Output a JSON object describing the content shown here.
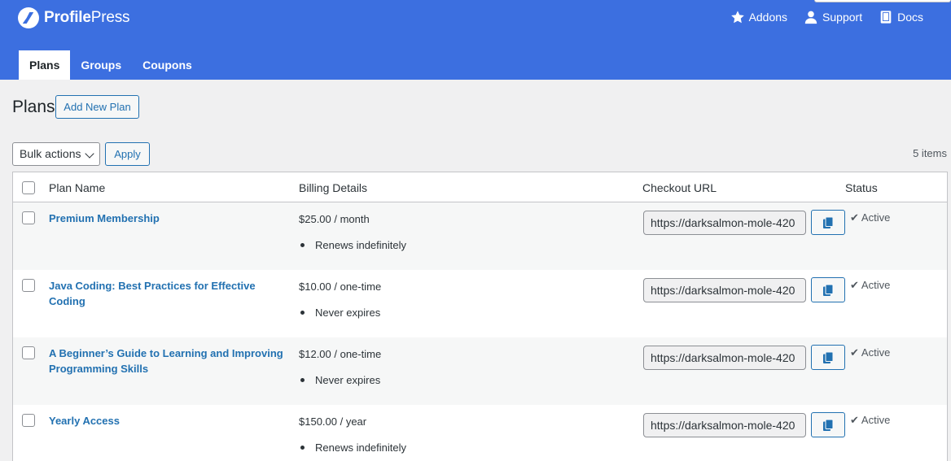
{
  "brand": {
    "name_bold": "Profile",
    "name_light": "Press"
  },
  "topnav": [
    {
      "label": "Addons",
      "icon": "star-icon"
    },
    {
      "label": "Support",
      "icon": "user-icon"
    },
    {
      "label": "Docs",
      "icon": "book-icon"
    }
  ],
  "tabs": [
    {
      "label": "Plans",
      "active": true
    },
    {
      "label": "Groups",
      "active": false
    },
    {
      "label": "Coupons",
      "active": false
    }
  ],
  "page": {
    "title": "Plans",
    "add_new_label": "Add New Plan"
  },
  "toolbar": {
    "bulk_actions": "Bulk actions",
    "apply_label": "Apply",
    "items_count": "5 items"
  },
  "table": {
    "columns": [
      "Plan Name",
      "Billing Details",
      "Checkout URL",
      "Status"
    ],
    "rows": [
      {
        "name": "Premium Membership",
        "price": "$25.00 / month",
        "note": "Renews indefinitely",
        "url": "https://darksalmon-mole-420",
        "status": "Active"
      },
      {
        "name": "Java Coding: Best Practices for Effective Coding",
        "price": "$10.00 / one-time",
        "note": "Never expires",
        "url": "https://darksalmon-mole-420",
        "status": "Active"
      },
      {
        "name": "A Beginner’s Guide to Learning and Improving Programming Skills",
        "price": "$12.00 / one-time",
        "note": "Never expires",
        "url": "https://darksalmon-mole-420",
        "status": "Active"
      },
      {
        "name": "Yearly Access",
        "price": "$150.00 / year",
        "note": "Renews indefinitely",
        "url": "https://darksalmon-mole-420",
        "status": "Active"
      }
    ]
  },
  "colors": {
    "header_bg": "#3c6fe0",
    "link": "#2271b1",
    "alt_row": "#f6f7f7"
  }
}
